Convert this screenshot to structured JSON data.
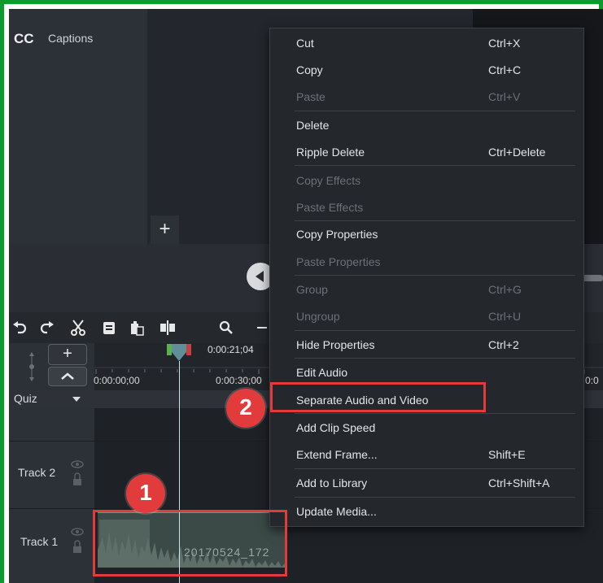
{
  "panel": {
    "cc_icon": "CC",
    "captions_label": "Captions",
    "add_tab_label": "+"
  },
  "toolbar": {
    "icons": [
      "undo-icon",
      "redo-icon",
      "cut-icon",
      "copy-icon",
      "paste-icon",
      "split-icon",
      "zoom-icon",
      "zoom-out-icon"
    ]
  },
  "timeline": {
    "add_track_label": "+",
    "playhead_time": "0:00:21;04",
    "timecodes": [
      "0:00:00;00",
      "0:00:30;00",
      "0:0"
    ],
    "quiz_label": "Quiz",
    "tracks": [
      {
        "label": "Track 2"
      },
      {
        "label": "Track 1"
      }
    ],
    "clip_name": "20170524_172"
  },
  "context_menu": {
    "items": [
      {
        "label": "Cut",
        "shortcut": "Ctrl+X",
        "enabled": true
      },
      {
        "label": "Copy",
        "shortcut": "Ctrl+C",
        "enabled": true
      },
      {
        "label": "Paste",
        "shortcut": "Ctrl+V",
        "enabled": false
      },
      {
        "label": "Delete",
        "shortcut": "",
        "enabled": true
      },
      {
        "label": "Ripple Delete",
        "shortcut": "Ctrl+Delete",
        "enabled": true
      },
      {
        "label": "Copy Effects",
        "shortcut": "",
        "enabled": false
      },
      {
        "label": "Paste Effects",
        "shortcut": "",
        "enabled": false
      },
      {
        "label": "Copy Properties",
        "shortcut": "",
        "enabled": true
      },
      {
        "label": "Paste Properties",
        "shortcut": "",
        "enabled": false
      },
      {
        "label": "Group",
        "shortcut": "Ctrl+G",
        "enabled": false
      },
      {
        "label": "Ungroup",
        "shortcut": "Ctrl+U",
        "enabled": false
      },
      {
        "label": "Hide Properties",
        "shortcut": "Ctrl+2",
        "enabled": true
      },
      {
        "label": "Edit Audio",
        "shortcut": "",
        "enabled": true
      },
      {
        "label": "Separate Audio and Video",
        "shortcut": "",
        "enabled": true
      },
      {
        "label": "Add Clip Speed",
        "shortcut": "",
        "enabled": true
      },
      {
        "label": "Extend Frame...",
        "shortcut": "Shift+E",
        "enabled": true
      },
      {
        "label": "Add to Library",
        "shortcut": "Ctrl+Shift+A",
        "enabled": true
      },
      {
        "label": "Update Media...",
        "shortcut": "",
        "enabled": true
      }
    ]
  },
  "annotations": {
    "badge_1": "1",
    "badge_2": "2"
  },
  "colors": {
    "frame_border": "#0a9a2e",
    "highlight": "#e23b3b",
    "menu_bg": "#24272c"
  }
}
